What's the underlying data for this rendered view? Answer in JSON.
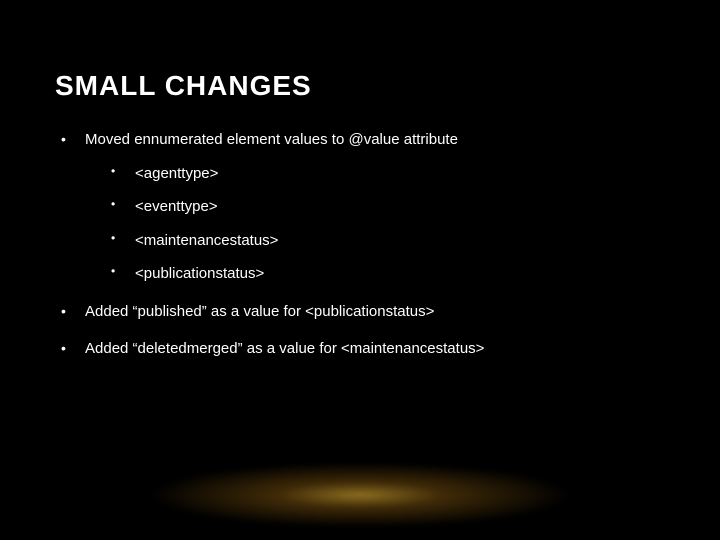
{
  "title": "SMALL CHANGES",
  "items": [
    {
      "text": "Moved ennumerated element values to @value attribute",
      "sub": [
        "<agenttype>",
        "<eventtype>",
        "<maintenancestatus>",
        "<publicationstatus>"
      ]
    },
    {
      "text": "Added “published” as a value for <publicationstatus>",
      "sub": []
    },
    {
      "text": "Added “deletedmerged” as a value for <maintenancestatus>",
      "sub": []
    }
  ]
}
